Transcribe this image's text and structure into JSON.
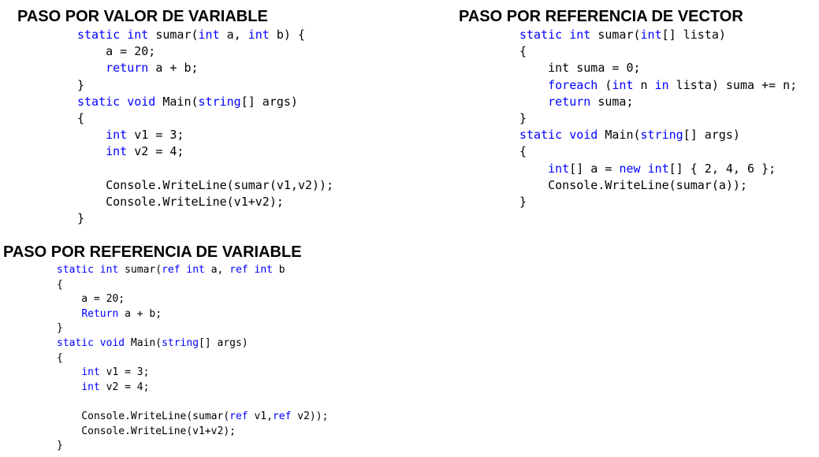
{
  "colors": {
    "keyword": "#0000ff",
    "text": "#000000",
    "background": "#ffffff"
  },
  "sections": [
    {
      "title": "PASO POR VALOR DE VARIABLE",
      "code_lines": [
        [
          [
            "kw",
            "static"
          ],
          [
            "tx",
            " "
          ],
          [
            "kw",
            "int"
          ],
          [
            "tx",
            " sumar("
          ],
          [
            "kw",
            "int"
          ],
          [
            "tx",
            " a, "
          ],
          [
            "kw",
            "int"
          ],
          [
            "tx",
            " b) {"
          ]
        ],
        [
          [
            "tx",
            "    a = 20;"
          ]
        ],
        [
          [
            "tx",
            "    "
          ],
          [
            "kw",
            "return"
          ],
          [
            "tx",
            " a + b;"
          ]
        ],
        [
          [
            "tx",
            "}"
          ]
        ],
        [
          [
            "kw",
            "static"
          ],
          [
            "tx",
            " "
          ],
          [
            "kw",
            "void"
          ],
          [
            "tx",
            " Main("
          ],
          [
            "kw",
            "string"
          ],
          [
            "tx",
            "[] args)"
          ]
        ],
        [
          [
            "tx",
            "{"
          ]
        ],
        [
          [
            "tx",
            "    "
          ],
          [
            "kw",
            "int"
          ],
          [
            "tx",
            " v1 = 3;"
          ]
        ],
        [
          [
            "tx",
            "    "
          ],
          [
            "kw",
            "int"
          ],
          [
            "tx",
            " v2 = 4;"
          ]
        ],
        [
          [
            "tx",
            ""
          ]
        ],
        [
          [
            "tx",
            "    Console.WriteLine(sumar(v1,v2));"
          ]
        ],
        [
          [
            "tx",
            "    Console.WriteLine(v1+v2);"
          ]
        ],
        [
          [
            "tx",
            "}"
          ]
        ]
      ]
    },
    {
      "title": "PASO POR REFERENCIA DE VECTOR",
      "code_lines": [
        [
          [
            "kw",
            "static"
          ],
          [
            "tx",
            " "
          ],
          [
            "kw",
            "int"
          ],
          [
            "tx",
            " sumar("
          ],
          [
            "kw",
            "int"
          ],
          [
            "tx",
            "[] lista)"
          ]
        ],
        [
          [
            "tx",
            "{"
          ]
        ],
        [
          [
            "tx",
            "    int suma = 0;"
          ]
        ],
        [
          [
            "tx",
            "    "
          ],
          [
            "kw",
            "foreach"
          ],
          [
            "tx",
            " ("
          ],
          [
            "kw",
            "int"
          ],
          [
            "tx",
            " n "
          ],
          [
            "kw",
            "in"
          ],
          [
            "tx",
            " lista) suma += n;"
          ]
        ],
        [
          [
            "tx",
            "    "
          ],
          [
            "kw",
            "return"
          ],
          [
            "tx",
            " suma;"
          ]
        ],
        [
          [
            "tx",
            "}"
          ]
        ],
        [
          [
            "kw",
            "static"
          ],
          [
            "tx",
            " "
          ],
          [
            "kw",
            "void"
          ],
          [
            "tx",
            " Main("
          ],
          [
            "kw",
            "string"
          ],
          [
            "tx",
            "[] args)"
          ]
        ],
        [
          [
            "tx",
            "{"
          ]
        ],
        [
          [
            "tx",
            "    "
          ],
          [
            "kw",
            "int"
          ],
          [
            "tx",
            "[] a = "
          ],
          [
            "kw",
            "new"
          ],
          [
            "tx",
            " "
          ],
          [
            "kw",
            "int"
          ],
          [
            "tx",
            "[] { 2, 4, 6 };"
          ]
        ],
        [
          [
            "tx",
            "    Console.WriteLine(sumar(a));"
          ]
        ],
        [
          [
            "tx",
            "}"
          ]
        ]
      ]
    },
    {
      "title": "PASO POR REFERENCIA DE VARIABLE",
      "code_lines": [
        [
          [
            "kw",
            "static"
          ],
          [
            "tx",
            " "
          ],
          [
            "kw",
            "int"
          ],
          [
            "tx",
            " sumar("
          ],
          [
            "kw",
            "ref"
          ],
          [
            "tx",
            " "
          ],
          [
            "kw",
            "int"
          ],
          [
            "tx",
            " a, "
          ],
          [
            "kw",
            "ref"
          ],
          [
            "tx",
            " "
          ],
          [
            "kw",
            "int"
          ],
          [
            "tx",
            " b"
          ]
        ],
        [
          [
            "tx",
            "{"
          ]
        ],
        [
          [
            "tx",
            "    a = 20;"
          ]
        ],
        [
          [
            "tx",
            "    "
          ],
          [
            "kw",
            "Return"
          ],
          [
            "tx",
            " a + b;"
          ]
        ],
        [
          [
            "tx",
            "}"
          ]
        ],
        [
          [
            "kw",
            "static"
          ],
          [
            "tx",
            " "
          ],
          [
            "kw",
            "void"
          ],
          [
            "tx",
            " Main("
          ],
          [
            "kw",
            "string"
          ],
          [
            "tx",
            "[] args)"
          ]
        ],
        [
          [
            "tx",
            "{"
          ]
        ],
        [
          [
            "tx",
            "    "
          ],
          [
            "kw",
            "int"
          ],
          [
            "tx",
            " v1 = 3;"
          ]
        ],
        [
          [
            "tx",
            "    "
          ],
          [
            "kw",
            "int"
          ],
          [
            "tx",
            " v2 = 4;"
          ]
        ],
        [
          [
            "tx",
            ""
          ]
        ],
        [
          [
            "tx",
            "    Console.WriteLine(sumar("
          ],
          [
            "kw",
            "ref"
          ],
          [
            "tx",
            " v1,"
          ],
          [
            "kw",
            "ref"
          ],
          [
            "tx",
            " v2));"
          ]
        ],
        [
          [
            "tx",
            "    Console.WriteLine(v1+v2);"
          ]
        ],
        [
          [
            "tx",
            "}"
          ]
        ]
      ]
    }
  ]
}
